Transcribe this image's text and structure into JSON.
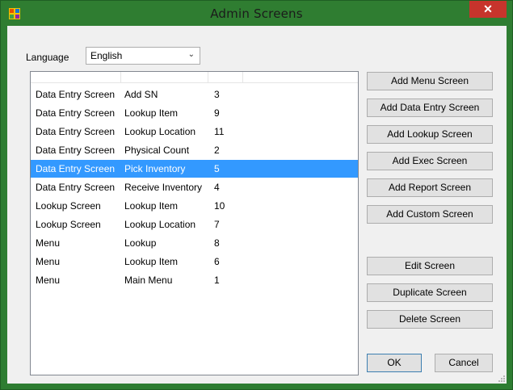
{
  "window": {
    "title": "Admin Screens",
    "close_glyph": "✕"
  },
  "language": {
    "label": "Language",
    "selected": "English"
  },
  "list": {
    "rows": [
      {
        "type": "Data Entry Screen",
        "name": "Add SN",
        "id": "3",
        "selected": false
      },
      {
        "type": "Data Entry Screen",
        "name": "Lookup Item",
        "id": "9",
        "selected": false
      },
      {
        "type": "Data Entry Screen",
        "name": "Lookup Location",
        "id": "11",
        "selected": false
      },
      {
        "type": "Data Entry Screen",
        "name": "Physical Count",
        "id": "2",
        "selected": false
      },
      {
        "type": "Data Entry Screen",
        "name": "Pick Inventory",
        "id": "5",
        "selected": true
      },
      {
        "type": "Data Entry Screen",
        "name": "Receive Inventory",
        "id": "4",
        "selected": false
      },
      {
        "type": "Lookup Screen",
        "name": "Lookup Item",
        "id": "10",
        "selected": false
      },
      {
        "type": "Lookup Screen",
        "name": "Lookup Location",
        "id": "7",
        "selected": false
      },
      {
        "type": "Menu",
        "name": "Lookup",
        "id": "8",
        "selected": false
      },
      {
        "type": "Menu",
        "name": "Lookup Item",
        "id": "6",
        "selected": false
      },
      {
        "type": "Menu",
        "name": "Main Menu",
        "id": "1",
        "selected": false
      }
    ]
  },
  "buttons": {
    "add_menu": "Add Menu Screen",
    "add_data_entry": "Add Data Entry Screen",
    "add_lookup": "Add Lookup Screen",
    "add_exec": "Add Exec Screen",
    "add_report": "Add Report Screen",
    "add_custom": "Add Custom Screen",
    "edit": "Edit Screen",
    "duplicate": "Duplicate Screen",
    "delete": "Delete Screen",
    "ok": "OK",
    "cancel": "Cancel"
  },
  "colors": {
    "title_bar": "#2f7d31",
    "selection": "#3399ff",
    "close": "#c7342c"
  }
}
